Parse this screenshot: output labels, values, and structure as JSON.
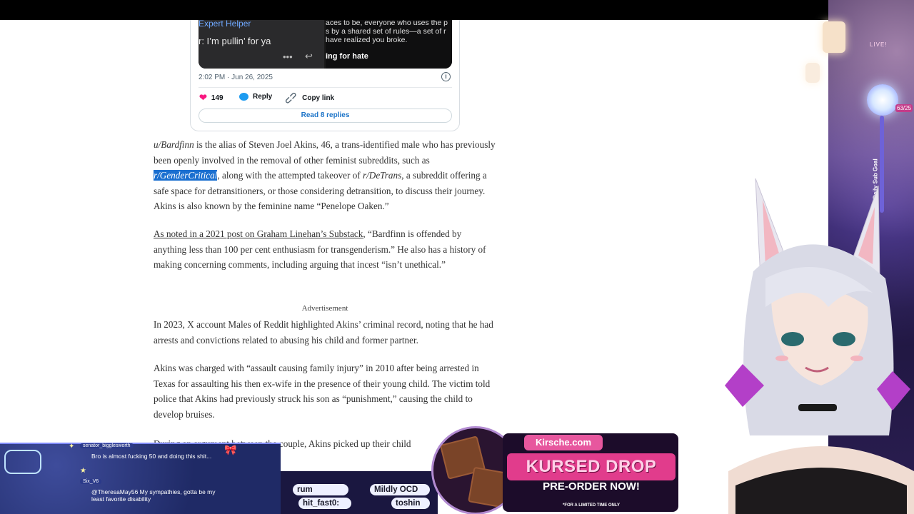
{
  "tweet": {
    "media": {
      "helper_label": "Expert Helper",
      "message": "r: I’m pullin’ for ya",
      "right_lines": [
        "aces to be, everyone who uses the p",
        "s by a shared set of rules—a set of r",
        "have realized you broke."
      ],
      "right_bold": "ing for hate"
    },
    "timestamp": "2:02 PM · Jun 26, 2025",
    "likes": "149",
    "reply_label": "Reply",
    "copy_link_label": "Copy link",
    "read_replies_label": "Read 8 replies"
  },
  "article": {
    "p1": {
      "user": "u/Bardfinn",
      "t1": " is the alias of Steven Joel Akins, 46, a trans-identified male who has previously been openly involved in the removal of other feminist subreddits, such as ",
      "highlight": "r/GenderCritical",
      "t2": ", along with the attempted takeover of ",
      "sub2": "r/DeTrans",
      "t3": ", a subreddit offering a safe space for detransitioners, or those considering detransition, to discuss their journey. Akins is also known by the feminine name “Penelope Oaken.”"
    },
    "p2": {
      "link": "As noted in a 2021 post on Graham Linehan’s Substack",
      "rest": ", “Bardfinn is offended by anything less than 100 per cent enthusiasm for transgenderism.” He also has a history of making concerning comments, including arguing that incest “isn’t unethical.”"
    },
    "ad_label": "Advertisement",
    "p3": "In 2023, X account Males of Reddit highlighted Akins’ criminal record, noting that he had arrests and convictions related to abusing his child and former partner.",
    "p4": "Akins was charged with “assault causing family injury” in 2010 after being arrested in Texas for assaulting his then ex-wife in the presence of their young child. The victim told police that Akins had previously struck his son as “punishment,” causing the child to develop bruises.",
    "p5_partial": "During an argument between the couple, Akins picked up their child"
  },
  "overlay": {
    "live_label": "LIVE!",
    "goal_label": "Daily Sub Goal",
    "goal_count": "63/25",
    "chat": [
      {
        "user": "senator_bigglesworth",
        "message": "Bro is almost fucking 50 and doing this shit..."
      },
      {
        "user": "Six_V6",
        "message": "@TheresaMay56 My sympathies, gotta be my least favorite disability"
      }
    ],
    "scores": [
      "rum",
      "Mildly OCD",
      "hit_fast0:",
      "toshin"
    ],
    "promo": {
      "brand": "Kirsche.com",
      "title": "KURSED DROP",
      "subtitle": "PRE-ORDER NOW!",
      "fine_print": "*FOR A LIMITED TIME ONLY"
    }
  },
  "colors": {
    "accent_link": "#1d74c8",
    "highlight": "#1a6fd0",
    "like": "#f91880",
    "promo_pink": "#e13c8c"
  }
}
